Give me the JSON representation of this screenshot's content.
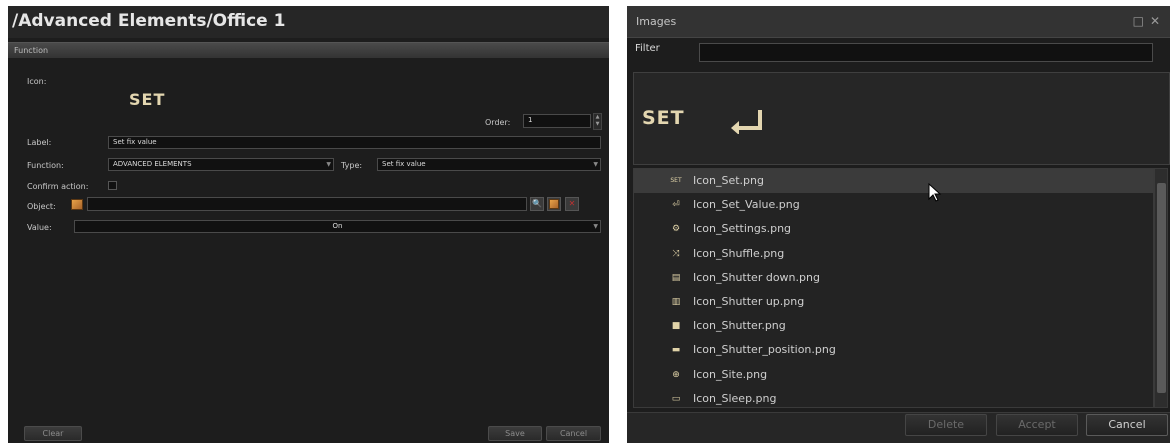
{
  "left": {
    "title": "/Advanced Elements/Office 1",
    "section": "Function",
    "icon_label": "Icon:",
    "icon_text": "SET",
    "order_label": "Order:",
    "order_value": "1",
    "label_label": "Label:",
    "label_value": "Set fix value",
    "function_label": "Function:",
    "function_value": "ADVANCED ELEMENTS",
    "type_label": "Type:",
    "type_value": "Set fix value",
    "confirm_label": "Confirm action:",
    "object_label": "Object:",
    "object_value": "",
    "value_label": "Value:",
    "value_value": "On",
    "clear_label": "Clear",
    "save_label": "Save",
    "cancel_label": "Cancel"
  },
  "dialog": {
    "title": "Images",
    "filter_label": "Filter",
    "filter_value": "",
    "preview_text": "SET",
    "items": [
      {
        "name": "Icon_Set.png",
        "icon": "SET",
        "icon_name": "set-text-icon"
      },
      {
        "name": "Icon_Set_Value.png",
        "icon": "⏎",
        "icon_name": "enter-arrow-icon"
      },
      {
        "name": "Icon_Settings.png",
        "icon": "⚙",
        "icon_name": "gear-icon"
      },
      {
        "name": "Icon_Shuffle.png",
        "icon": "⤨",
        "icon_name": "shuffle-icon"
      },
      {
        "name": "Icon_Shutter down.png",
        "icon": "▤",
        "icon_name": "shutter-down-icon"
      },
      {
        "name": "Icon_Shutter up.png",
        "icon": "▥",
        "icon_name": "shutter-up-icon"
      },
      {
        "name": "Icon_Shutter.png",
        "icon": "■",
        "icon_name": "shutter-icon"
      },
      {
        "name": "Icon_Shutter_position.png",
        "icon": "▬",
        "icon_name": "shutter-position-icon"
      },
      {
        "name": "Icon_Site.png",
        "icon": "⊕",
        "icon_name": "globe-icon"
      },
      {
        "name": "Icon_Sleep.png",
        "icon": "▭",
        "icon_name": "sleep-icon"
      }
    ],
    "delete_label": "Delete",
    "accept_label": "Accept",
    "cancel_label": "Cancel"
  },
  "colors": {
    "accent_text": "#e3d6b0",
    "background": "#1d1d1d"
  }
}
